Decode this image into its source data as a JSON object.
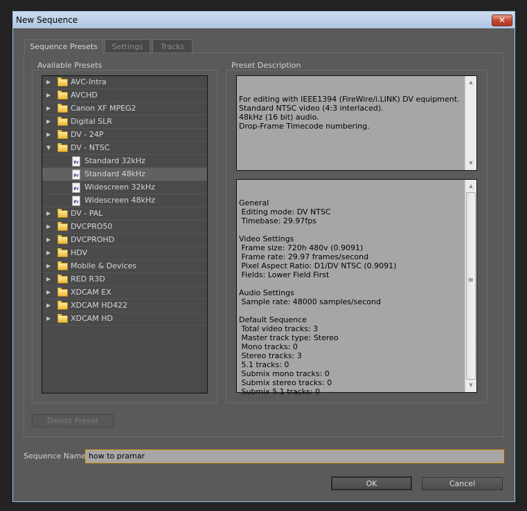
{
  "window": {
    "title": "New Sequence",
    "close_icon": "close-icon"
  },
  "tabs": [
    {
      "label": "Sequence Presets",
      "active": true
    },
    {
      "label": "Settings",
      "active": false
    },
    {
      "label": "Tracks",
      "active": false
    }
  ],
  "presets": {
    "label": "Available Presets",
    "items": [
      {
        "label": "AVC-Intra",
        "type": "folder",
        "expanded": false
      },
      {
        "label": "AVCHD",
        "type": "folder",
        "expanded": false
      },
      {
        "label": "Canon XF MPEG2",
        "type": "folder",
        "expanded": false
      },
      {
        "label": "Digital SLR",
        "type": "folder",
        "expanded": false
      },
      {
        "label": "DV - 24P",
        "type": "folder",
        "expanded": false
      },
      {
        "label": "DV - NTSC",
        "type": "folder",
        "expanded": true
      },
      {
        "label": "Standard 32kHz",
        "type": "preset"
      },
      {
        "label": "Standard 48kHz",
        "type": "preset",
        "selected": true
      },
      {
        "label": "Widescreen 32kHz",
        "type": "preset"
      },
      {
        "label": "Widescreen 48kHz",
        "type": "preset"
      },
      {
        "label": "DV - PAL",
        "type": "folder",
        "expanded": false
      },
      {
        "label": "DVCPRO50",
        "type": "folder",
        "expanded": false
      },
      {
        "label": "DVCPROHD",
        "type": "folder",
        "expanded": false
      },
      {
        "label": "HDV",
        "type": "folder",
        "expanded": false
      },
      {
        "label": "Mobile & Devices",
        "type": "folder",
        "expanded": false
      },
      {
        "label": "RED R3D",
        "type": "folder",
        "expanded": false
      },
      {
        "label": "XDCAM EX",
        "type": "folder",
        "expanded": false
      },
      {
        "label": "XDCAM HD422",
        "type": "folder",
        "expanded": false
      },
      {
        "label": "XDCAM HD",
        "type": "folder",
        "expanded": false
      }
    ],
    "delete_label": "Delete Preset"
  },
  "description": {
    "label": "Preset Description",
    "text": "For editing with IEEE1394 (FireWire/i.LINK) DV equipment.\nStandard NTSC video (4:3 interlaced).\n48kHz (16 bit) audio.\nDrop-Frame Timecode numbering.",
    "settings": "General\n Editing mode: DV NTSC\n Timebase: 29.97fps\n\nVideo Settings\n Frame size: 720h 480v (0.9091)\n Frame rate: 29.97 frames/second\n Pixel Aspect Ratio: D1/DV NTSC (0.9091)\n Fields: Lower Field First\n\nAudio Settings\n Sample rate: 48000 samples/second\n\nDefault Sequence\n Total video tracks: 3\n Master track type: Stereo\n Mono tracks: 0\n Stereo tracks: 3\n 5.1 tracks: 0\n Submix mono tracks: 0\n Submix stereo tracks: 0\n Submix 5.1 tracks: 0"
  },
  "sequence_name": {
    "label": "Sequence Name:",
    "value": "how to pramar"
  },
  "buttons": {
    "ok": "OK",
    "cancel": "Cancel"
  },
  "colors": {
    "focus": "#e0a010",
    "panel": "#5a5a5a",
    "titlebar": "#aec6e2"
  }
}
